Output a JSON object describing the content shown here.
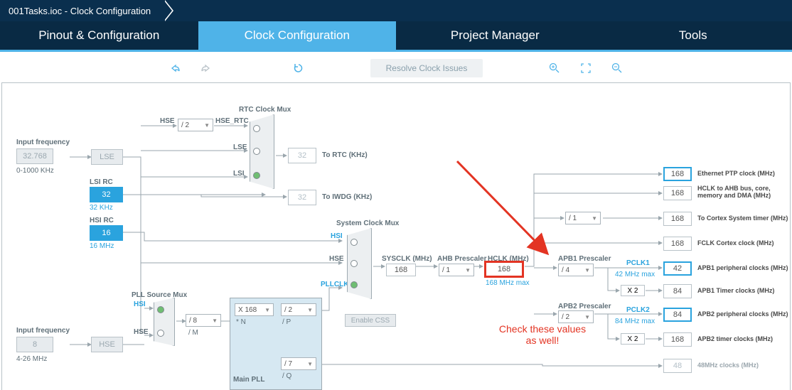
{
  "breadcrumb": {
    "title": "001Tasks.ioc - Clock Configuration"
  },
  "tabs": {
    "pinout": "Pinout & Configuration",
    "clock": "Clock Configuration",
    "project": "Project Manager",
    "tools": "Tools"
  },
  "toolbar": {
    "resolve": "Resolve Clock Issues"
  },
  "diagram": {
    "rtcmux_title": "RTC Clock Mux",
    "sysclk_title": "System Clock Mux",
    "pllsrc_title": "PLL Source Mux",
    "main_pll": "Main PLL",
    "input_freq_lbl": "Input frequency",
    "input_freq_top_val": "32.768",
    "input_freq_top_range": "0-1000 KHz",
    "input_freq_bot_val": "8",
    "input_freq_bot_range": "4-26 MHz",
    "lse_btn": "LSE",
    "lsi_lbl": "LSI RC",
    "lsi_val": "32",
    "lsi_unit": "32 KHz",
    "hsi_lbl": "HSI RC",
    "hsi_val": "16",
    "hsi_unit": "16 MHz",
    "hse_btn": "HSE",
    "hse_tag": "HSE",
    "hse_rtc_tag": "HSE_RTC",
    "hse_div": "/ 2",
    "lse_tag": "LSE",
    "lsi_tag": "LSI",
    "hsi_tag": "HSI",
    "pllclk_tag": "PLLCLK",
    "sysclk_tag": "SYSCLK (MHz)",
    "to_rtc": "To RTC (KHz)",
    "to_iwdg": "To IWDG (KHz)",
    "rtc_val": "32",
    "iwdg_val": "32",
    "pll_m": "/ 8",
    "pll_m_lbl": "/ M",
    "pll_n": "X 168",
    "pll_n_lbl": "* N",
    "pll_p": "/ 2",
    "pll_p_lbl": "/ P",
    "pll_q": "/ 7",
    "pll_q_lbl": "/ Q",
    "enable_css": "Enable CSS",
    "sysclk_val": "168",
    "ahb_pre_lbl": "AHB Prescaler",
    "ahb_pre": "/ 1",
    "hclk_lbl": "HCLK (MHz)",
    "hclk_val": "168",
    "hclk_note": "168 MHz max",
    "apb1_pre_lbl": "APB1 Prescaler",
    "apb1_pre": "/ 4",
    "apb2_pre_lbl": "APB2 Prescaler",
    "apb2_pre": "/ 2",
    "systimer_pre": "/ 1",
    "pclk1_tag": "PCLK1",
    "pclk1_note": "42 MHz max",
    "pclk2_tag": "PCLK2",
    "pclk2_note": "84 MHz max",
    "x2": "X 2",
    "out_eth": "168",
    "out_eth_lbl": "Ethernet PTP clock (MHz)",
    "out_hclk": "168",
    "out_hclk_lbl": "HCLK to AHB bus, core, memory and DMA (MHz)",
    "out_systick": "168",
    "out_systick_lbl": "To Cortex System timer (MHz)",
    "out_fclk": "168",
    "out_fclk_lbl": "FCLK Cortex clock (MHz)",
    "out_apb1p": "42",
    "out_apb1p_lbl": "APB1 peripheral clocks (MHz)",
    "out_apb1t": "84",
    "out_apb1t_lbl": "APB1 Timer clocks (MHz)",
    "out_apb2p": "84",
    "out_apb2p_lbl": "APB2 peripheral clocks (MHz)",
    "out_apb2t": "168",
    "out_apb2t_lbl": "APB2 timer clocks (MHz)",
    "out_48m": "48",
    "out_48m_lbl": "48MHz clocks (MHz)",
    "annot_text": "Check these values\nas well!"
  }
}
